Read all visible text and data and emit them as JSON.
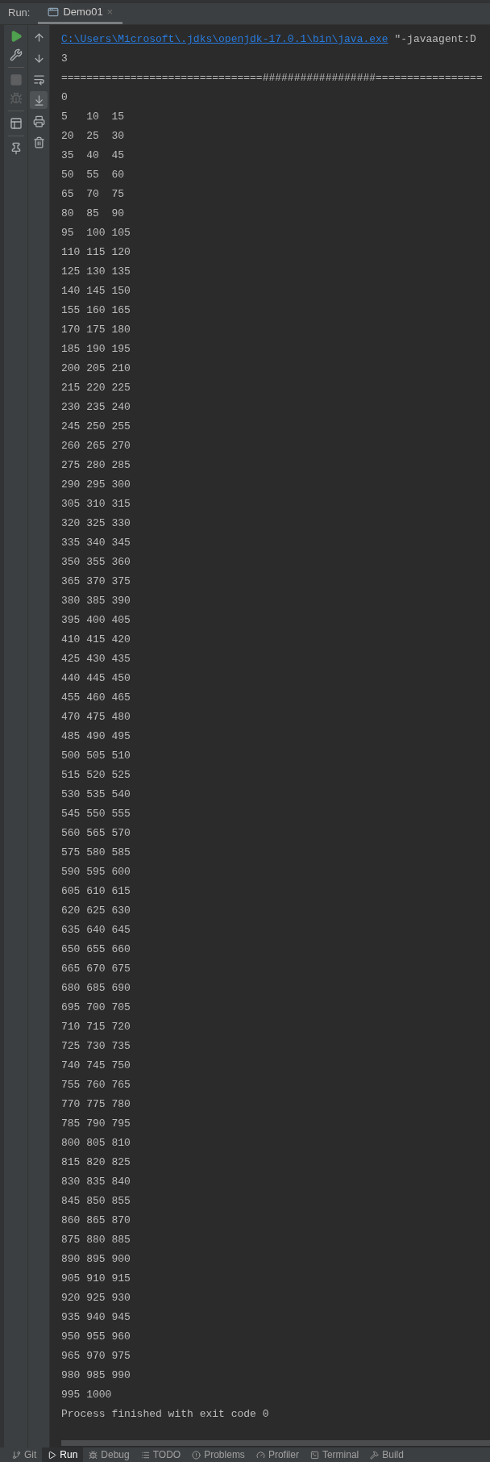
{
  "header": {
    "label": "Run:",
    "tabs": [
      {
        "label": "Demo01",
        "close": "×",
        "selected": true
      }
    ]
  },
  "left_toolbar": [
    {
      "kind": "run",
      "disabled": false
    },
    {
      "kind": "settings",
      "disabled": false
    },
    {
      "kind": "divider"
    },
    {
      "kind": "stop",
      "disabled": true
    },
    {
      "kind": "debug",
      "disabled": true
    },
    {
      "kind": "divider"
    },
    {
      "kind": "layout",
      "disabled": false
    },
    {
      "kind": "divider"
    },
    {
      "kind": "pin",
      "disabled": false
    }
  ],
  "console_toolbar": [
    {
      "kind": "up",
      "selected": false
    },
    {
      "kind": "down",
      "selected": false
    },
    {
      "kind": "wrap",
      "selected": false
    },
    {
      "kind": "scroll-end",
      "selected": true
    },
    {
      "kind": "print",
      "selected": false
    },
    {
      "kind": "trash",
      "selected": false
    }
  ],
  "console": {
    "command_link": "C:\\Users\\Microsoft\\.jdks\\openjdk-17.0.1\\bin\\java.exe",
    "command_rest": " \"-javaagent:D",
    "lines": [
      "3",
      "================================##################=================",
      "0",
      "5   10  15",
      "20  25  30",
      "35  40  45",
      "50  55  60",
      "65  70  75",
      "80  85  90",
      "95  100 105",
      "110 115 120",
      "125 130 135",
      "140 145 150",
      "155 160 165",
      "170 175 180",
      "185 190 195",
      "200 205 210",
      "215 220 225",
      "230 235 240",
      "245 250 255",
      "260 265 270",
      "275 280 285",
      "290 295 300",
      "305 310 315",
      "320 325 330",
      "335 340 345",
      "350 355 360",
      "365 370 375",
      "380 385 390",
      "395 400 405",
      "410 415 420",
      "425 430 435",
      "440 445 450",
      "455 460 465",
      "470 475 480",
      "485 490 495",
      "500 505 510",
      "515 520 525",
      "530 535 540",
      "545 550 555",
      "560 565 570",
      "575 580 585",
      "590 595 600",
      "605 610 615",
      "620 625 630",
      "635 640 645",
      "650 655 660",
      "665 670 675",
      "680 685 690",
      "695 700 705",
      "710 715 720",
      "725 730 735",
      "740 745 750",
      "755 760 765",
      "770 775 780",
      "785 790 795",
      "800 805 810",
      "815 820 825",
      "830 835 840",
      "845 850 855",
      "860 865 870",
      "875 880 885",
      "890 895 900",
      "905 910 915",
      "920 925 930",
      "935 940 945",
      "950 955 960",
      "965 970 975",
      "980 985 990",
      "995 1000",
      "Process finished with exit code 0"
    ]
  },
  "bottom_bar": [
    {
      "kind": "git",
      "label": "Git",
      "selected": false
    },
    {
      "kind": "run",
      "label": "Run",
      "selected": true
    },
    {
      "kind": "debug",
      "label": "Debug",
      "selected": false
    },
    {
      "kind": "todo",
      "label": "TODO",
      "selected": false
    },
    {
      "kind": "problems",
      "label": "Problems",
      "selected": false
    },
    {
      "kind": "profiler",
      "label": "Profiler",
      "selected": false
    },
    {
      "kind": "terminal",
      "label": "Terminal",
      "selected": false
    },
    {
      "kind": "build",
      "label": "Build",
      "selected": false
    }
  ]
}
